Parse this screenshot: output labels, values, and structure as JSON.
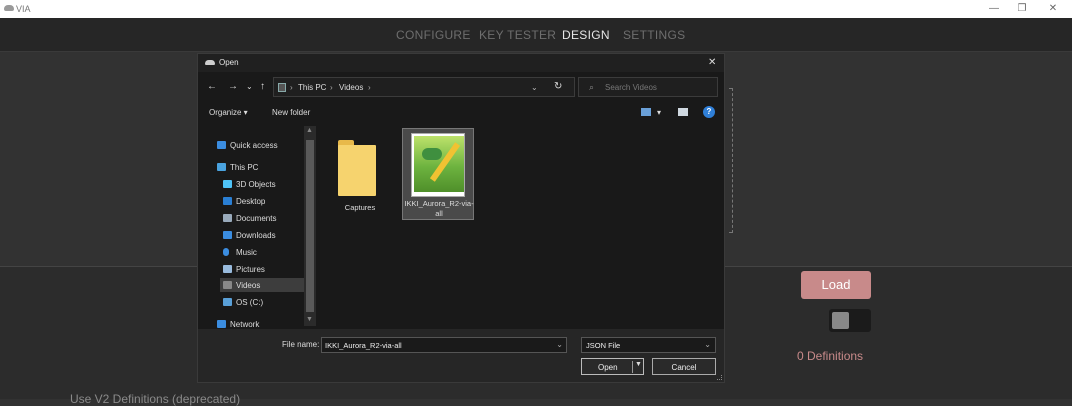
{
  "app": {
    "title": "VIA"
  },
  "window_controls": {
    "minimize": "—",
    "restore": "❐",
    "close": "✕"
  },
  "tabs": [
    {
      "label": "CONFIGURE"
    },
    {
      "label": "KEY TESTER"
    },
    {
      "label": "DESIGN"
    },
    {
      "label": "SETTINGS"
    }
  ],
  "load_button": "Load",
  "definitions_text": "0 Definitions",
  "bottom_partial": "Use V2 Definitions (deprecated)",
  "dialog": {
    "title": "Open",
    "close": "✕",
    "nav": {
      "back": "←",
      "forward": "→",
      "recent": "⌄",
      "up": "↑"
    },
    "address": [
      "This PC",
      "Videos"
    ],
    "address_dropdown": "⌄",
    "refresh": "↻",
    "search_placeholder": "Search Videos",
    "search_icon": "⌕",
    "toolbar": {
      "organize": "Organize ▾",
      "new_folder": "New folder",
      "view_arrow": "▾",
      "help": "?"
    },
    "nav_pane": [
      {
        "label": "Quick access",
        "icon": "star-icon",
        "color": "#3b8de0"
      },
      {
        "label": "This PC",
        "icon": "computer-icon",
        "color": "#4aa3df"
      },
      {
        "label": "3D Objects",
        "icon": "cube-icon",
        "color": "#4fc3f7"
      },
      {
        "label": "Desktop",
        "icon": "desktop-icon",
        "color": "#2a7fd4"
      },
      {
        "label": "Documents",
        "icon": "document-icon",
        "color": "#9ab"
      },
      {
        "label": "Downloads",
        "icon": "download-icon",
        "color": "#3b8de0"
      },
      {
        "label": "Music",
        "icon": "music-icon",
        "color": "#3b8de0"
      },
      {
        "label": "Pictures",
        "icon": "pictures-icon",
        "color": "#9bd"
      },
      {
        "label": "Videos",
        "icon": "videos-icon",
        "color": "#888"
      },
      {
        "label": "OS (C:)",
        "icon": "drive-icon",
        "color": "#5aa0d8"
      },
      {
        "label": "Network",
        "icon": "network-icon",
        "color": "#3b8de0"
      }
    ],
    "files": [
      {
        "name": "Captures",
        "icon": "folder-icon"
      },
      {
        "name": "IKKI_Aurora_R2-via-all",
        "icon": "notepadpp-file-icon"
      }
    ],
    "filename_label": "File name:",
    "filename_value": "IKKI_Aurora_R2-via-all",
    "filetype_value": "JSON File",
    "open_button": "Open",
    "cancel_button": "Cancel"
  }
}
